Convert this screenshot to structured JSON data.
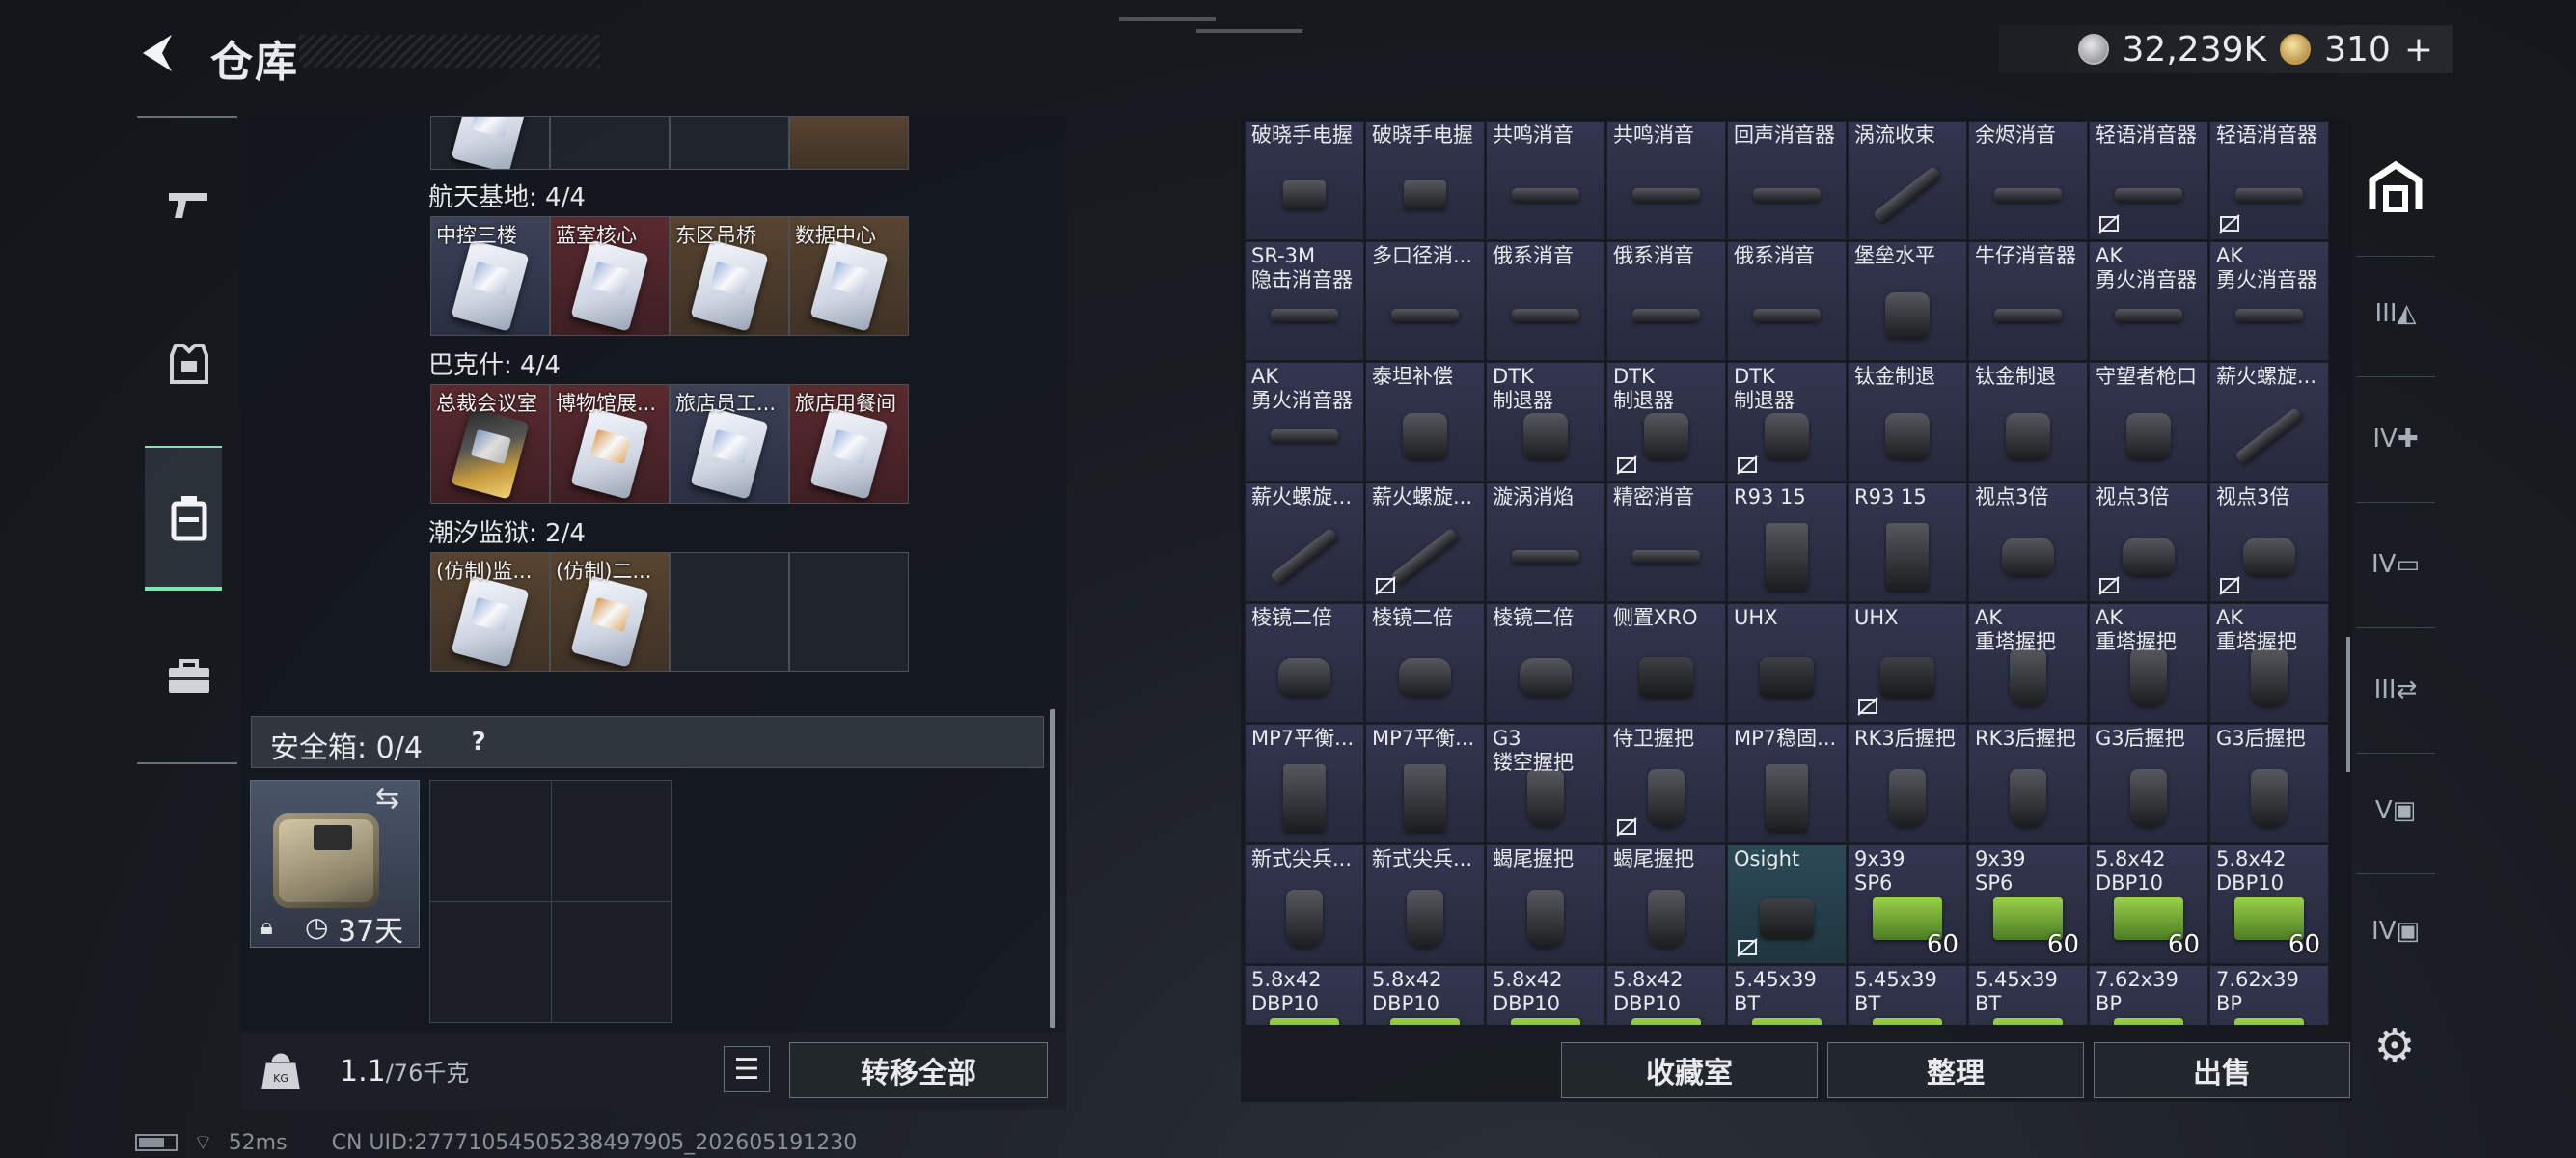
{
  "header": {
    "title": "仓库",
    "back_icon": "back-arrow-icon"
  },
  "currency": {
    "silver_value": "32,239K",
    "gold_value": "310",
    "add_label": "+"
  },
  "left_nav": {
    "items": [
      {
        "id": "weapons",
        "icon": "pistol-icon"
      },
      {
        "id": "armor",
        "icon": "vest-icon"
      },
      {
        "id": "backpack",
        "icon": "backpack-icon",
        "active": true
      },
      {
        "id": "toolbox",
        "icon": "toolbox-icon"
      }
    ]
  },
  "keys": {
    "groups": [
      {
        "region": "航天基地: 4/4",
        "cards": [
          {
            "label": "中控三楼",
            "bg": "blue"
          },
          {
            "label": "蓝室核心",
            "bg": "red"
          },
          {
            "label": "东区吊桥",
            "bg": "gold"
          },
          {
            "label": "数据中心",
            "bg": "gold"
          }
        ]
      },
      {
        "region": "巴克什: 4/4",
        "cards": [
          {
            "label": "总裁会议室",
            "bg": "red",
            "card": "gold"
          },
          {
            "label": "博物馆展...",
            "bg": "red",
            "card": "orange"
          },
          {
            "label": "旅店员工...",
            "bg": "blue"
          },
          {
            "label": "旅店用餐间",
            "bg": "red"
          }
        ]
      },
      {
        "region": "潮汐监狱: 2/4",
        "cards": [
          {
            "label": "(仿制)监...",
            "bg": "gold"
          },
          {
            "label": "(仿制)二...",
            "bg": "gold",
            "card": "orange"
          },
          {
            "label": "",
            "bg": "empty"
          },
          {
            "label": "",
            "bg": "empty"
          }
        ]
      }
    ]
  },
  "safebox": {
    "title": "安全箱: 0/4",
    "help": "?",
    "days": "37天"
  },
  "footer_left": {
    "weight": "1.1",
    "weight_cap": "/76千克",
    "kg_label": "KG",
    "transfer_label": "转移全部",
    "list_icon": "list-icon"
  },
  "status": {
    "ping": "52ms",
    "uid": "CN UID:27771054505238497905_202605191230"
  },
  "grid": {
    "rows": [
      [
        {
          "n": "破晓手电握",
          "k": "flash"
        },
        {
          "n": "破晓手电握",
          "k": "flash"
        },
        {
          "n": "共鸣消音",
          "k": "sup"
        },
        {
          "n": "共鸣消音",
          "k": "sup"
        },
        {
          "n": "回声消音器",
          "k": "sup"
        },
        {
          "n": "涡流收束",
          "k": "rail"
        },
        {
          "n": "余烬消音",
          "k": "sup"
        },
        {
          "n": "轻语消音器",
          "k": "sup",
          "x": true
        },
        {
          "n": "轻语消音器",
          "k": "sup",
          "x": true
        }
      ],
      [
        {
          "n": "SR-3M\n隐击消音器",
          "k": "sup"
        },
        {
          "n": "多口径消...",
          "k": "sup"
        },
        {
          "n": "俄系消音",
          "k": "sup"
        },
        {
          "n": "俄系消音",
          "k": "sup"
        },
        {
          "n": "俄系消音",
          "k": "sup"
        },
        {
          "n": "堡垒水平",
          "k": "brake"
        },
        {
          "n": "牛仔消音器",
          "k": "sup"
        },
        {
          "n": "AK\n勇火消音器",
          "k": "sup"
        },
        {
          "n": "AK\n勇火消音器",
          "k": "sup"
        }
      ],
      [
        {
          "n": "AK\n勇火消音器",
          "k": "sup"
        },
        {
          "n": "泰坦补偿",
          "k": "brake"
        },
        {
          "n": "DTK\n制退器",
          "k": "brake"
        },
        {
          "n": "DTK\n制退器",
          "k": "brake",
          "x": true
        },
        {
          "n": "DTK\n制退器",
          "k": "brake",
          "x": true
        },
        {
          "n": "钛金制退",
          "k": "brake"
        },
        {
          "n": "钛金制退",
          "k": "brake"
        },
        {
          "n": "守望者枪口",
          "k": "brake"
        },
        {
          "n": "薪火螺旋...",
          "k": "rail"
        }
      ],
      [
        {
          "n": "薪火螺旋...",
          "k": "rail"
        },
        {
          "n": "薪火螺旋...",
          "k": "rail",
          "x": true
        },
        {
          "n": "漩涡消焰",
          "k": "sup"
        },
        {
          "n": "精密消音",
          "k": "sup"
        },
        {
          "n": "R93 15",
          "k": "mag"
        },
        {
          "n": "R93 15",
          "k": "mag"
        },
        {
          "n": "视点3倍",
          "k": "scope"
        },
        {
          "n": "视点3倍",
          "k": "scope",
          "x": true
        },
        {
          "n": "视点3倍",
          "k": "scope",
          "x": true
        }
      ],
      [
        {
          "n": "棱镜二倍",
          "k": "scope"
        },
        {
          "n": "棱镜二倍",
          "k": "scope"
        },
        {
          "n": "棱镜二倍",
          "k": "scope"
        },
        {
          "n": "侧置XRO",
          "k": "holo"
        },
        {
          "n": "UHX",
          "k": "holo"
        },
        {
          "n": "UHX",
          "k": "holo",
          "x": true
        },
        {
          "n": "AK\n重塔握把",
          "k": "grip"
        },
        {
          "n": "AK\n重塔握把",
          "k": "grip"
        },
        {
          "n": "AK\n重塔握把",
          "k": "grip"
        }
      ],
      [
        {
          "n": "MP7平衡...",
          "k": "mag"
        },
        {
          "n": "MP7平衡...",
          "k": "mag"
        },
        {
          "n": "G3\n镂空握把",
          "k": "grip"
        },
        {
          "n": "侍卫握把",
          "k": "grip",
          "x": true
        },
        {
          "n": "MP7稳固...",
          "k": "mag"
        },
        {
          "n": "RK3后握把",
          "k": "grip"
        },
        {
          "n": "RK3后握把",
          "k": "grip"
        },
        {
          "n": "G3后握把",
          "k": "grip"
        },
        {
          "n": "G3后握把",
          "k": "grip"
        }
      ],
      [
        {
          "n": "新式尖兵...",
          "k": "grip"
        },
        {
          "n": "新式尖兵...",
          "k": "grip"
        },
        {
          "n": "蝎尾握把",
          "k": "grip"
        },
        {
          "n": "蝎尾握把",
          "k": "grip"
        },
        {
          "n": "Osight",
          "k": "holo",
          "x": true,
          "teal": true
        },
        {
          "n": "9x39\nSP6",
          "k": "box",
          "c": "60"
        },
        {
          "n": "9x39\nSP6",
          "k": "box",
          "c": "60"
        },
        {
          "n": "5.8x42\nDBP10",
          "k": "box",
          "c": "60"
        },
        {
          "n": "5.8x42\nDBP10",
          "k": "box",
          "c": "60"
        }
      ],
      [
        {
          "n": "5.8x42\nDBP10",
          "k": "box"
        },
        {
          "n": "5.8x42\nDBP10",
          "k": "box"
        },
        {
          "n": "5.8x42\nDBP10",
          "k": "box"
        },
        {
          "n": "5.8x42\nDBP10",
          "k": "box"
        },
        {
          "n": "5.45x39\nBT",
          "k": "box"
        },
        {
          "n": "5.45x39\nBT",
          "k": "box"
        },
        {
          "n": "5.45x39\nBT",
          "k": "box"
        },
        {
          "n": "7.62x39\nBP",
          "k": "box"
        },
        {
          "n": "7.62x39\nBP",
          "k": "box"
        }
      ]
    ]
  },
  "right_sidebar": {
    "items": [
      {
        "icon": "warehouse-icon",
        "label": ""
      },
      {
        "icon": "tier-3-kit-icon",
        "label": "III"
      },
      {
        "icon": "tier-4-medkit-icon",
        "label": "IV"
      },
      {
        "icon": "tier-4-folder-icon",
        "label": "IV"
      },
      {
        "icon": "tier-3-swap-icon",
        "label": "III"
      },
      {
        "icon": "tier-5-card-icon",
        "label": "V"
      },
      {
        "icon": "tier-4-card-icon",
        "label": "IV"
      }
    ]
  },
  "footer_right": {
    "collection_label": "收藏室",
    "sort_label": "整理",
    "sell_label": "出售",
    "settings_icon": "gear-icon"
  }
}
